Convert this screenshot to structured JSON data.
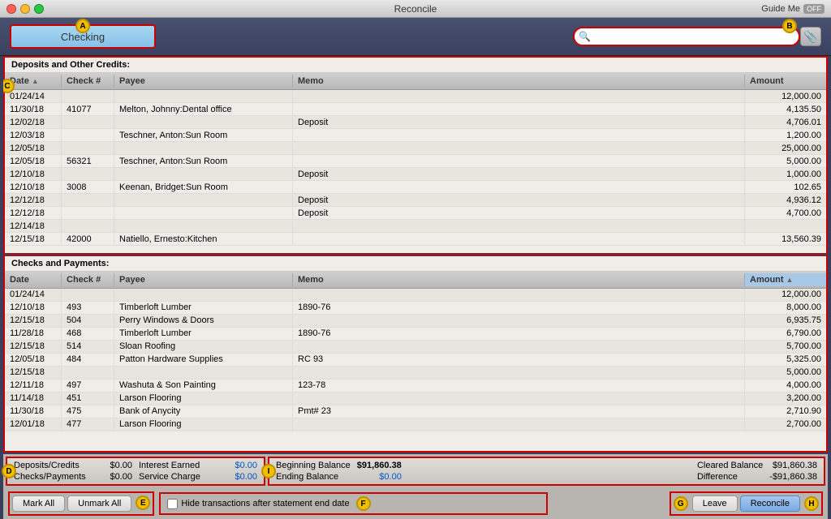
{
  "window": {
    "title": "Reconcile",
    "guide_me": "Guide Me",
    "toggle": "OFF"
  },
  "toolbar": {
    "account": "Checking",
    "search_placeholder": ""
  },
  "labels": {
    "a": "A",
    "b": "B",
    "c": "C",
    "d": "D",
    "e": "E",
    "f": "F",
    "g": "G",
    "h": "H",
    "i": "I"
  },
  "deposits": {
    "section_title": "Deposits and Other Credits:",
    "columns": [
      "Date",
      "Check #",
      "Payee",
      "Memo",
      "Amount"
    ],
    "rows": [
      {
        "date": "01/24/14",
        "check": "",
        "payee": "",
        "memo": "",
        "amount": "12,000.00"
      },
      {
        "date": "11/30/18",
        "check": "41077",
        "payee": "Melton, Johnny:Dental office",
        "memo": "",
        "amount": "4,135.50"
      },
      {
        "date": "12/02/18",
        "check": "",
        "payee": "",
        "memo": "Deposit",
        "amount": "4,706.01"
      },
      {
        "date": "12/03/18",
        "check": "",
        "payee": "Teschner, Anton:Sun Room",
        "memo": "",
        "amount": "1,200.00"
      },
      {
        "date": "12/05/18",
        "check": "",
        "payee": "",
        "memo": "",
        "amount": "25,000.00"
      },
      {
        "date": "12/05/18",
        "check": "56321",
        "payee": "Teschner, Anton:Sun Room",
        "memo": "",
        "amount": "5,000.00"
      },
      {
        "date": "12/10/18",
        "check": "",
        "payee": "",
        "memo": "Deposit",
        "amount": "1,000.00"
      },
      {
        "date": "12/10/18",
        "check": "3008",
        "payee": "Keenan, Bridget:Sun Room",
        "memo": "",
        "amount": "102.65"
      },
      {
        "date": "12/12/18",
        "check": "",
        "payee": "",
        "memo": "Deposit",
        "amount": "4,936.12"
      },
      {
        "date": "12/12/18",
        "check": "",
        "payee": "",
        "memo": "Deposit",
        "amount": "4,700.00"
      },
      {
        "date": "12/14/18",
        "check": "",
        "payee": "",
        "memo": "",
        "amount": ""
      },
      {
        "date": "12/15/18",
        "check": "42000",
        "payee": "Natiello, Ernesto:Kitchen",
        "memo": "",
        "amount": "13,560.39"
      }
    ]
  },
  "payments": {
    "section_title": "Checks and Payments:",
    "columns": [
      "Date",
      "Check #",
      "Payee",
      "Memo",
      "Amount"
    ],
    "rows": [
      {
        "date": "01/24/14",
        "check": "",
        "payee": "",
        "memo": "",
        "amount": "12,000.00"
      },
      {
        "date": "12/10/18",
        "check": "493",
        "payee": "Timberloft Lumber",
        "memo": "1890-76",
        "amount": "8,000.00"
      },
      {
        "date": "12/15/18",
        "check": "504",
        "payee": "Perry Windows & Doors",
        "memo": "",
        "amount": "6,935.75"
      },
      {
        "date": "11/28/18",
        "check": "468",
        "payee": "Timberloft Lumber",
        "memo": "1890-76",
        "amount": "6,790.00"
      },
      {
        "date": "12/15/18",
        "check": "514",
        "payee": "Sloan Roofing",
        "memo": "",
        "amount": "5,700.00"
      },
      {
        "date": "12/05/18",
        "check": "484",
        "payee": "Patton Hardware Supplies",
        "memo": "RC 93",
        "amount": "5,325.00"
      },
      {
        "date": "12/15/18",
        "check": "",
        "payee": "",
        "memo": "",
        "amount": "5,000.00"
      },
      {
        "date": "12/11/18",
        "check": "497",
        "payee": "Washuta & Son Painting",
        "memo": "123-78",
        "amount": "4,000.00"
      },
      {
        "date": "11/14/18",
        "check": "451",
        "payee": "Larson Flooring",
        "memo": "",
        "amount": "3,200.00"
      },
      {
        "date": "11/30/18",
        "check": "475",
        "payee": "Bank of Anycity",
        "memo": "Pmt# 23",
        "amount": "2,710.90"
      },
      {
        "date": "12/01/18",
        "check": "477",
        "payee": "Larson Flooring",
        "memo": "",
        "amount": "2,700.00"
      }
    ]
  },
  "bottom": {
    "deposits_credits_label": "Deposits/Credits",
    "deposits_credits_value": "$0.00",
    "checks_payments_label": "Checks/Payments",
    "checks_payments_value": "$0.00",
    "interest_earned_label": "Interest Earned",
    "interest_earned_value": "$0.00",
    "service_charge_label": "Service Charge",
    "service_charge_value": "$0.00",
    "beginning_balance_label": "Beginning Balance",
    "beginning_balance_value": "$91,860.38",
    "ending_balance_label": "Ending Balance",
    "ending_balance_value": "$0.00",
    "cleared_balance_label": "Cleared Balance",
    "cleared_balance_value": "$91,860.38",
    "difference_label": "Difference",
    "difference_value": "-$91,860.38"
  },
  "buttons": {
    "mark_all": "Mark All",
    "unmark_all": "Unmark All",
    "hide_transactions": "Hide transactions after statement end date",
    "leave": "Leave",
    "reconcile": "Reconcile"
  }
}
